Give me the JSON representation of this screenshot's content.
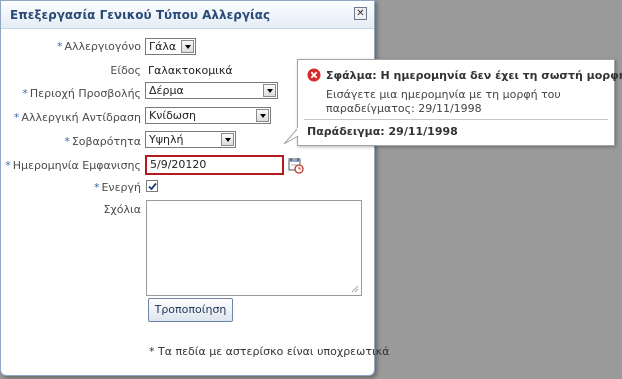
{
  "dialog": {
    "title": "Επεξεργασία Γενικού Τύπου Αλλεργίας",
    "close_icon": "close-icon"
  },
  "form": {
    "allergen": {
      "label": "Αλλεργιογόνο",
      "value": "Γάλα"
    },
    "type": {
      "label": "Είδος",
      "value": "Γαλακτοκομικά"
    },
    "exposure_area": {
      "label": "Περιοχή Προσβολής",
      "value": "Δέρμα"
    },
    "reaction": {
      "label": "Αλλεργική Αντίδραση",
      "value": "Κνίδωση"
    },
    "severity": {
      "label": "Σοβαρότητα",
      "value": "Υψηλή"
    },
    "onset_date": {
      "label": "Ημερομηνία Εμφανισης",
      "value": "5/9/20120",
      "icon": "calendar-icon"
    },
    "active": {
      "label": "Ενεργή",
      "checked": true
    },
    "comments": {
      "label": "Σχόλια",
      "value": ""
    },
    "required_marker": "*",
    "submit_label": "Τροποποίηση",
    "footnote": "* Τα πεδία με αστερίσκο είναι υποχρεωτικά"
  },
  "error_popup": {
    "title": "Σφάλμα: Η ημερομηνία δεν έχει τη σωστή μορφή.",
    "message": "Εισάγετε μια ημερομηνία με τη μορφή του παραδείγματος: 29/11/1998",
    "example": "Παράδειγμα: 29/11/1998",
    "icon": "error-icon"
  },
  "colors": {
    "error_border": "#b4191e",
    "required_marker": "#3e6aa6",
    "title": "#2a4a77"
  }
}
